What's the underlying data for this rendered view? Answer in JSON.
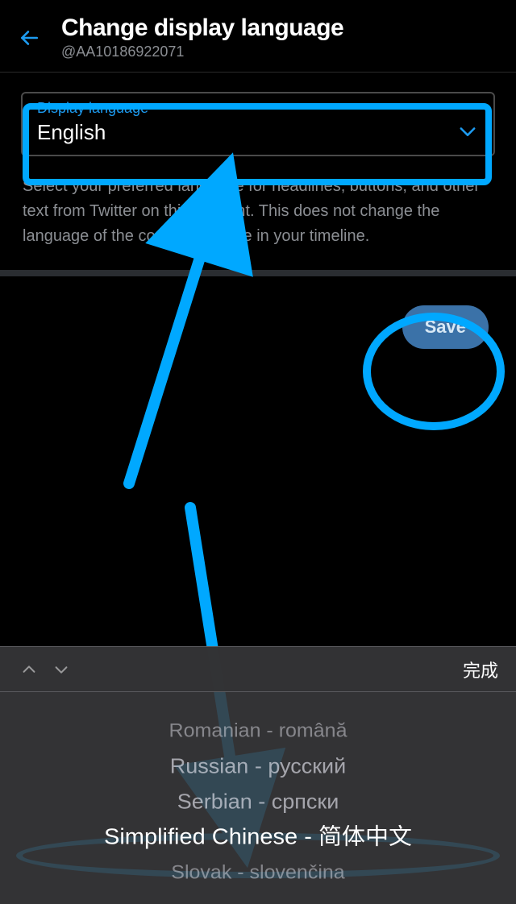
{
  "header": {
    "title": "Change display language",
    "handle": "@AA10186922071"
  },
  "field": {
    "label": "Display language",
    "value": "English"
  },
  "help_text": "Select your preferred language for headlines, buttons, and other text from Twitter on this account. This does not change the language of the content you see in your timeline.",
  "save_label": "Save",
  "picker": {
    "done_label": "完成",
    "options": {
      "0": "Romanian - română",
      "1": "Russian - русский",
      "2": "Serbian - српски",
      "3": "Simplified Chinese - 简体中文",
      "4": "Slovak - slovenčina"
    }
  },
  "colors": {
    "accent": "#1d9bf0",
    "annotation": "#00a8ff"
  }
}
